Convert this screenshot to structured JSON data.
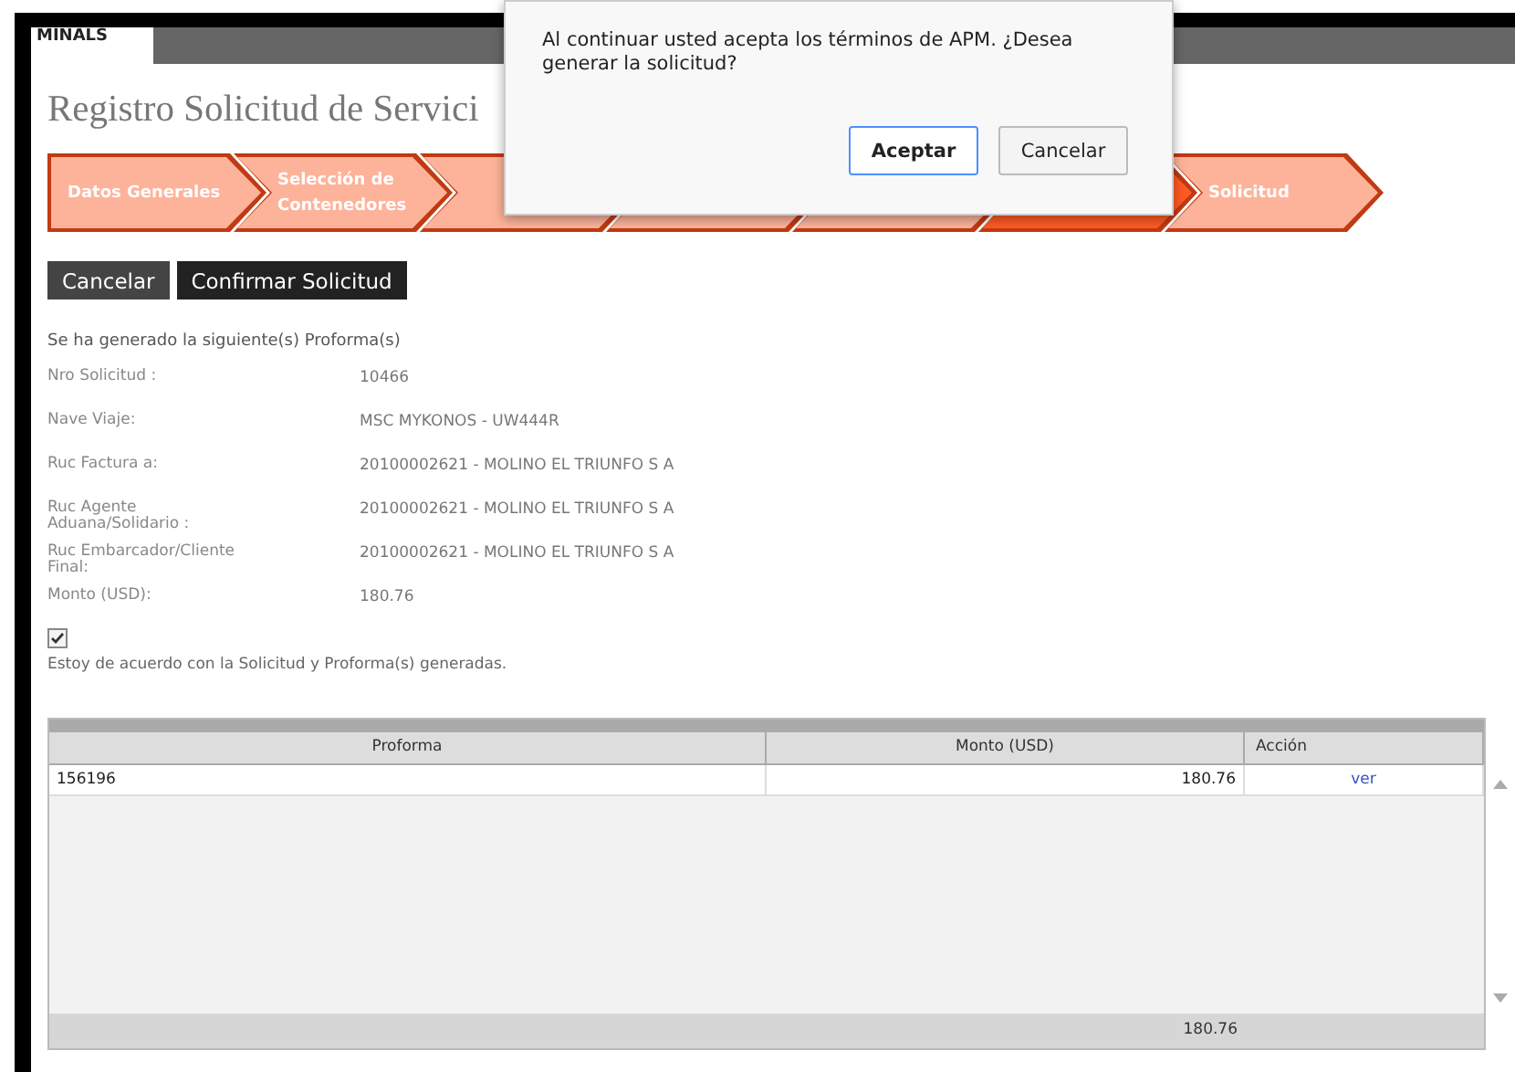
{
  "header": {
    "logo": "MINALS"
  },
  "page_title": "Registro Solicitud de Servici",
  "steps": [
    {
      "label": "Datos Generales",
      "selected": false
    },
    {
      "label": "Selección de Contenedores",
      "selected": false
    },
    {
      "selected": false
    },
    {
      "selected": false
    },
    {
      "selected": false
    },
    {
      "selected": true
    },
    {
      "label": "Solicitud",
      "selected": false
    }
  ],
  "actions": [
    "Cancelar",
    "Confirmar Solicitud"
  ],
  "intro": "Se ha generado la siguiente(s) Proforma(s)",
  "fields": [
    {
      "label": "Nro Solicitud :",
      "value": "10466"
    },
    {
      "label": "Nave Viaje:",
      "value": "MSC MYKONOS - UW444R"
    },
    {
      "label": "Ruc Factura a:",
      "value": "20100002621 - MOLINO EL TRIUNFO S A"
    },
    {
      "label": "Ruc Agente Aduana/Solidario :",
      "value": "20100002621 - MOLINO EL TRIUNFO S A"
    },
    {
      "label": "Ruc Embarcador/Cliente Final:",
      "value": "20100002621 - MOLINO EL TRIUNFO S A"
    },
    {
      "label": "Monto (USD):",
      "value": "180.76"
    }
  ],
  "agreement": {
    "checked": true,
    "label": "Estoy de acuerdo con la Solicitud y Proforma(s) generadas."
  },
  "table": {
    "columns": [
      "Proforma",
      "Monto (USD)",
      "Acción"
    ],
    "rows": [
      {
        "proforma": "156196",
        "monto": "180.76",
        "action": "ver"
      }
    ],
    "footer_total": "180.76"
  },
  "dialog": {
    "message": "Al continuar usted acepta los términos de APM. ¿Desea generar la solicitud?",
    "buttons": [
      {
        "label": "Aceptar",
        "focused": true
      },
      {
        "label": "Cancelar",
        "focused": false
      }
    ]
  }
}
